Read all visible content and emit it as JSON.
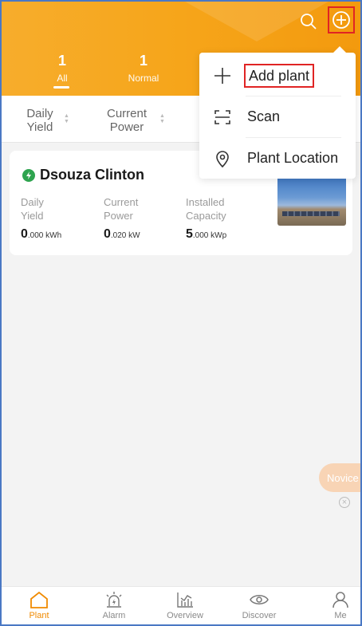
{
  "header": {
    "tabs": [
      {
        "count": "1",
        "label": "All"
      },
      {
        "count": "1",
        "label": "Normal"
      }
    ]
  },
  "sort": {
    "daily_yield": [
      "Daily",
      "Yield"
    ],
    "current_power": [
      "Current",
      "Power"
    ]
  },
  "plant": {
    "name": "Dsouza Clinton",
    "metrics": [
      {
        "label": [
          "Daily",
          "Yield"
        ],
        "value": "0",
        "unit": ".000 kWh"
      },
      {
        "label": [
          "Current",
          "Power"
        ],
        "value": "0",
        "unit": ".020 kW"
      },
      {
        "label": [
          "Installed",
          "Capacity"
        ],
        "value": "5",
        "unit": ".000 kWp"
      }
    ]
  },
  "menu": {
    "add_plant": "Add plant",
    "scan": "Scan",
    "plant_location": "Plant Location"
  },
  "novice": "Novice",
  "tabbar": {
    "plant": "Plant",
    "alarm": "Alarm",
    "overview": "Overview",
    "discover": "Discover",
    "me": "Me"
  },
  "colors": {
    "accent": "#f08a00",
    "header": "#f6a51a",
    "online": "#2ea44f"
  }
}
